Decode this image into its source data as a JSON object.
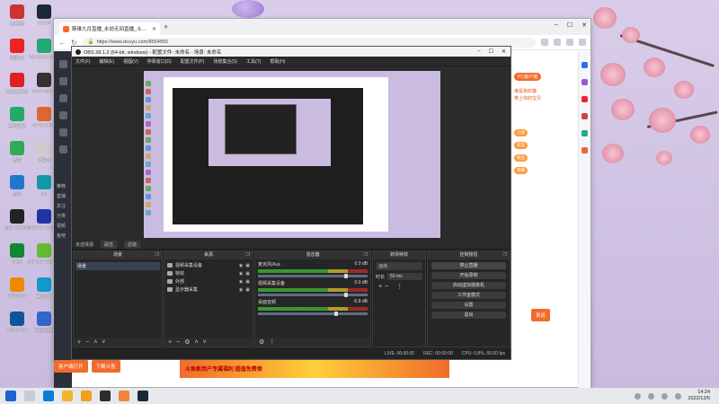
{
  "desktop": {
    "icons": [
      {
        "label": "此电脑",
        "color": "#c33"
      },
      {
        "label": "Steam",
        "color": "#1b2838"
      },
      {
        "label": "回收站",
        "color": "#e22"
      },
      {
        "label": "Microsoft Edge",
        "color": "#2a7"
      },
      {
        "label": "网易云音乐",
        "color": "#d22"
      },
      {
        "label": "OBS Studio",
        "color": "#333"
      },
      {
        "label": "腾讯会议",
        "color": "#2a6"
      },
      {
        "label": "WPS Office",
        "color": "#d63"
      },
      {
        "label": "微信",
        "color": "#3a5"
      },
      {
        "label": "记事本",
        "color": "#ccc"
      },
      {
        "label": "迅雷",
        "color": "#27c"
      },
      {
        "label": "QQ",
        "color": "#19a"
      },
      {
        "label": "Epic Games",
        "color": "#222"
      },
      {
        "label": "Ubisoft Connect",
        "color": "#23a"
      },
      {
        "label": "Xbox",
        "color": "#183"
      },
      {
        "label": "GeForce Experience",
        "color": "#6b3"
      },
      {
        "label": "WeGame",
        "color": "#e80"
      },
      {
        "label": "腾讯QQ",
        "color": "#19c"
      },
      {
        "label": "Battle.net",
        "color": "#159"
      },
      {
        "label": "百度网盘",
        "color": "#36c"
      }
    ]
  },
  "browser": {
    "tab_title": "斯维九月直播_永劫无间直播_斗...",
    "url": "https://www.douyu.com/8554555",
    "page": {
      "left_labels": [
        "推荐",
        "直播",
        "关注",
        "分类",
        "视频",
        "鱼吧"
      ],
      "right_badge": "PC客户端",
      "right_lines": [
        "谁是我的猫",
        "带上你的宝贝"
      ],
      "right_pills": [
        "订阅",
        "贵族",
        "粉丝",
        "弹幕"
      ],
      "send_button": "发送",
      "bottom_banner": "斗鱼新用户专属福利 超值免费领",
      "bottom_left_buttons": [
        "客户端打开",
        "下载斗鱼"
      ]
    }
  },
  "obs": {
    "title": "OBS 28.1.2 (64-bit, windows) - 配置文件: 未命名 - 场景: 未命名",
    "menu": [
      "文件(F)",
      "编辑(E)",
      "视图(V)",
      "停靠窗口(D)",
      "配置文件(P)",
      "场景集合(S)",
      "工具(T)",
      "帮助(H)"
    ],
    "status_row": {
      "scene_label": "未选择源",
      "props": "属性",
      "filters": "滤镜"
    },
    "docks": {
      "scenes": {
        "title": "场景",
        "items": [
          "场景"
        ]
      },
      "sources": {
        "title": "来源",
        "items": [
          "视频采集设备",
          "特效",
          "外部",
          "显示器采集"
        ]
      },
      "mixer": {
        "title": "混音器",
        "channels": [
          {
            "name": "麦克风/Aux",
            "db": "0.0 dB"
          },
          {
            "name": "视频采集设备",
            "db": "0.0 dB"
          },
          {
            "name": "桌面音频",
            "db": "-5.8 dB"
          }
        ]
      },
      "transitions": {
        "title": "转场特效",
        "type": "淡出",
        "duration_label": "时长",
        "duration": "50 ms"
      },
      "controls": {
        "title": "控制按钮",
        "buttons": [
          "停止直播",
          "开始录制",
          "启动虚拟摄像机",
          "工作室模式",
          "设置",
          "退出"
        ]
      }
    },
    "bottom": {
      "live": "LIVE: 00:00:00",
      "rec": "REC: 00:00:00",
      "cpu": "CPU: 0.8%, 60.00 fps"
    }
  },
  "taskbar": {
    "time": "14:24",
    "date": "2022/12/5"
  }
}
